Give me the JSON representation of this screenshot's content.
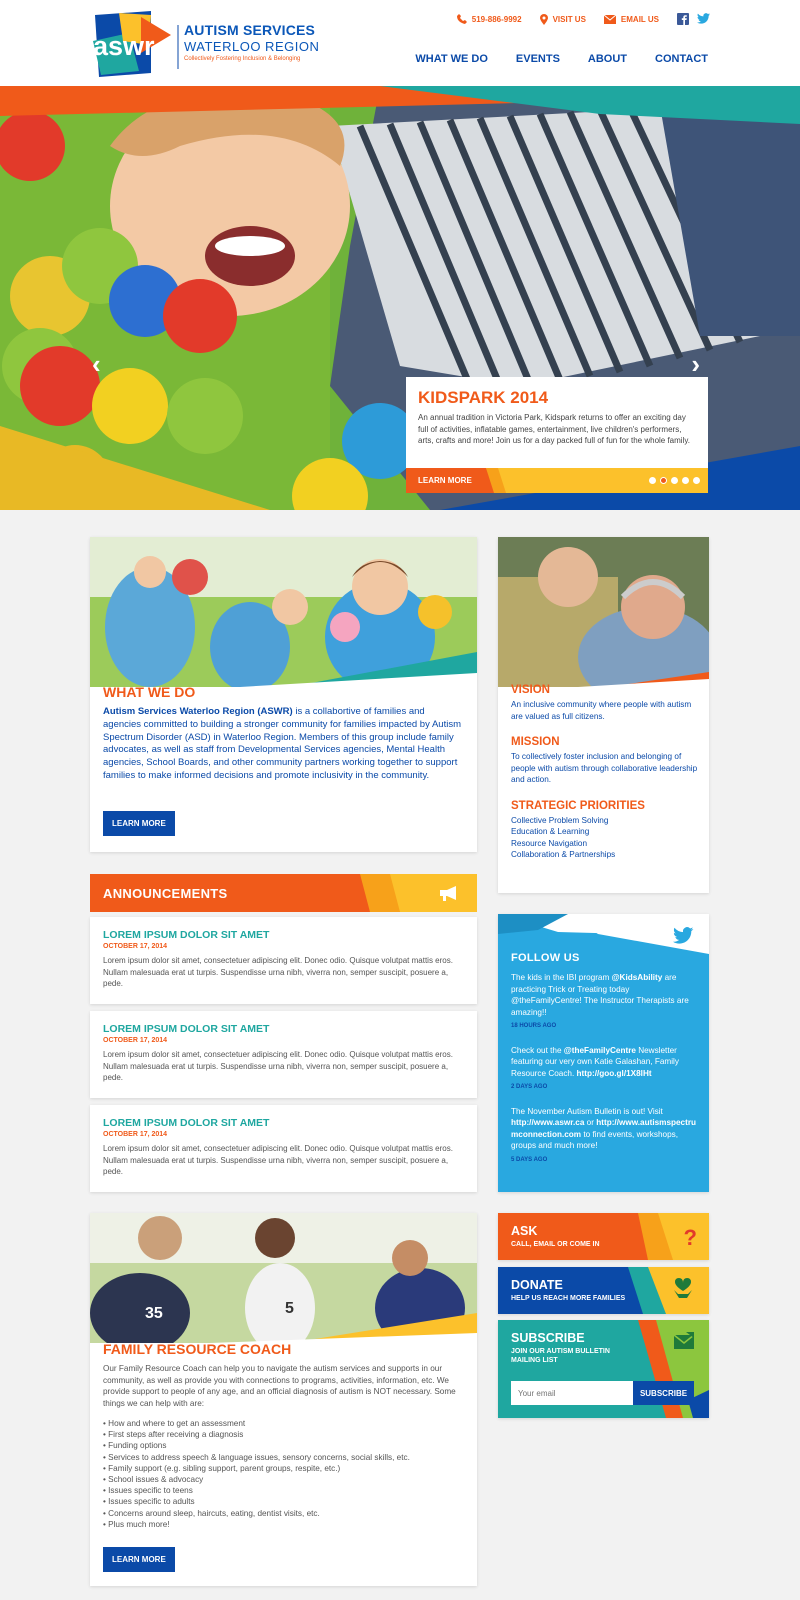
{
  "brand": {
    "logo_mark": "aswr",
    "name_line1": "AUTISM SERVICES",
    "name_line2": "WATERLOO REGION",
    "tagline": "Collectively Fostering Inclusion & Belonging"
  },
  "topbar": {
    "phone": "519-886-9992",
    "visit": "VISIT US",
    "email": "EMAIL US",
    "phone_icon": "phone-icon",
    "visit_icon": "map-pin-icon",
    "email_icon": "envelope-icon"
  },
  "nav": {
    "items": [
      "WHAT WE DO",
      "EVENTS",
      "ABOUT",
      "CONTACT"
    ]
  },
  "hero": {
    "title": "KIDSPARK 2014",
    "text": "An annual tradition in Victoria Park, Kidspark returns to offer an exciting day full of activities, inflatable games, entertainment, live children's performers, arts, crafts and more! Join us for a day packed full of fun for the whole family.",
    "cta": "LEARN MORE",
    "prev": "‹",
    "next": "›",
    "active_slide": 2,
    "slide_count": 5
  },
  "what_we_do": {
    "title": "WHAT WE DO",
    "lead": "Autism Services Waterloo Region (ASWR)",
    "text": " is a collabortive of families and agencies committed to building a stronger community for families impacted by Autism Spectrum Disorder (ASD) in Waterloo Region. Members of this group include family advocates, as well as staff from Developmental Services agencies, Mental Health agencies, School Boards, and other community partners working together to support families to make informed decisions  and promote inclusivity in the community.",
    "cta": "LEARN MORE"
  },
  "vision": {
    "vision_title": "VISION",
    "vision_text": "An inclusive community where people with autism are valued as full citizens.",
    "mission_title": "MISSION",
    "mission_text": "To collectively foster inclusion and belonging of people with autism through collaborative leadership and action.",
    "priorities_title": "STRATEGIC PRIORITIES",
    "priorities": [
      "Collective Problem Solving",
      "Education & Learning",
      "Resource Navigation",
      "Collaboration & Partnerships"
    ]
  },
  "announcements": {
    "title": "ANNOUNCEMENTS",
    "items": [
      {
        "title": "LOREM IPSUM DOLOR SIT AMET",
        "date": "OCTOBER 17, 2014",
        "text": "Lorem ipsum dolor sit amet, consectetuer adipiscing elit. Donec odio. Quisque volutpat mattis eros. Nullam malesuada erat ut turpis. Suspendisse urna nibh, viverra non, semper suscipit, posuere a, pede."
      },
      {
        "title": "LOREM IPSUM DOLOR SIT AMET",
        "date": "OCTOBER 17, 2014",
        "text": "Lorem ipsum dolor sit amet, consectetuer adipiscing elit. Donec odio. Quisque volutpat mattis eros. Nullam malesuada erat ut turpis. Suspendisse urna nibh, viverra non, semper suscipit, posuere a, pede."
      },
      {
        "title": "LOREM IPSUM DOLOR SIT AMET",
        "date": "OCTOBER 17, 2014",
        "text": "Lorem ipsum dolor sit amet, consectetuer adipiscing elit. Donec odio. Quisque volutpat mattis eros. Nullam malesuada erat ut turpis. Suspendisse urna nibh, viverra non, semper suscipit, posuere a, pede."
      }
    ]
  },
  "follow": {
    "title": "FOLLOW US",
    "t1_a": "The kids in the IBI program ",
    "t1_b": "@KidsAbility",
    "t1_c": " are practicing Trick or Treating today @theFamilyCentre!  The Instructor Therapists are amazing!!",
    "t1_ago": "18 HOURS AGO",
    "t2_a": "Check out the ",
    "t2_b": "@theFamilyCentre",
    "t2_c": " Newsletter featuring our very own Katie Galashan, Family Resource Coach. ",
    "t2_d": "http://goo.gl/1X8lHt",
    "t2_ago": "2 DAYS AGO",
    "t3_a": "The November Autism Bulletin is out! Visit ",
    "t3_b": "http://www.aswr.ca",
    "t3_c": "  or ",
    "t3_d": "http://www.autismspectrumconnection.com",
    "t3_e": "  to find events, workshops, groups and much more!",
    "t3_ago": "5 DAYS AGO"
  },
  "frc": {
    "title": "FAMILY RESOURCE COACH",
    "text": "Our Family Resource Coach can help you to navigate the autism services and supports in our community, as well as provide you with connections to programs, activities, information, etc. We provide support to people of any age, and an official diagnosis of autism is NOT necessary. Some things we can help with are:",
    "items": [
      "How and where to get an assessment",
      "First steps after receiving a diagnosis",
      "Funding options",
      "Services to address speech & language issues, sensory concerns, social skills, etc.",
      "Family support (e.g. sibling support, parent groups, respite, etc.)",
      "School issues & advocacy",
      "Issues specific to teens",
      "Issues specific to adults",
      "Concerns around sleep, haircuts, eating, dentist visits, etc.",
      "Plus much more!"
    ],
    "cta": "LEARN MORE"
  },
  "ask": {
    "title": "ASK",
    "sub": "CALL, EMAIL OR COME IN",
    "icon": "question-icon",
    "glyph": "?"
  },
  "donate": {
    "title": "DONATE",
    "sub": "HELP US REACH MORE FAMILIES",
    "icon": "heart-hands-icon"
  },
  "subscribe": {
    "title": "SUBSCRIBE",
    "sub": "JOIN OUR AUTISM BULLETIN MAILING LIST",
    "placeholder": "Your email",
    "button": "SUBSCRIBE",
    "icon": "mail-icon"
  },
  "colors": {
    "orange": "#f05a1a",
    "blue": "#0b4aa8",
    "teal": "#1fa7a0",
    "yellow": "#fcc12b",
    "sky": "#29a8e0"
  }
}
